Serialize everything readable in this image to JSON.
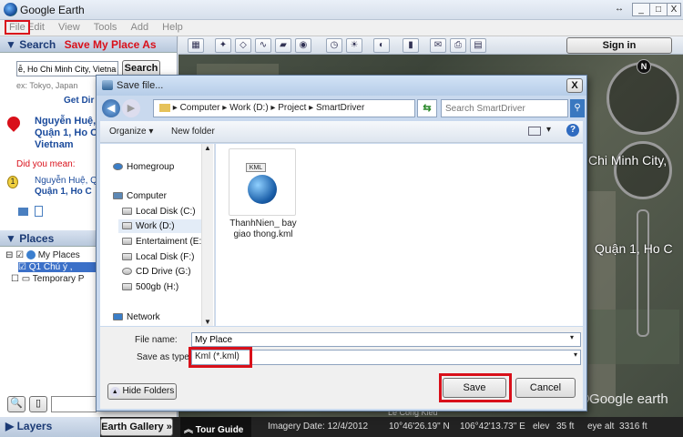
{
  "window": {
    "title": "Google Earth",
    "controls": {
      "resize": "↔",
      "minimize": "_",
      "maximize": "□",
      "close": "X"
    }
  },
  "menu": [
    "File",
    "Edit",
    "View",
    "Tools",
    "Add",
    "Help"
  ],
  "search_panel": {
    "header": "▼ Search",
    "annotation": "Save My Place As",
    "query": "ễ, Ho Chi Minh City, Vietnam",
    "search_button": "Search",
    "example": "ex: Tokyo, Japan",
    "get_directions": "Get Dir",
    "result_line1": "Nguyễn Huệ,",
    "result_line2": "Quận 1, Ho C",
    "result_line3": "Vietnam",
    "did_you_mean": "Did you mean:",
    "suggestion_line1": "Nguyễn Huệ, Q",
    "suggestion_line2": "Quận 1, Ho C"
  },
  "places_panel": {
    "header": "▼ Places",
    "my_places": "My Places",
    "item": "Q1 Chú ý ,",
    "temporary": "Temporary P"
  },
  "layers": {
    "header": "▶ Layers",
    "earth_gallery": "Earth Gallery »"
  },
  "toolbar": {
    "sign_in": "Sign in"
  },
  "map": {
    "label1": "Chi Minh City,",
    "label2": "Quận 1, Ho C",
    "watermark": "©Google earth",
    "compass": "N",
    "overlay_text": "Lê Công Kiều"
  },
  "status": {
    "tour_guide": "Tour Guide",
    "imagery_date": "Imagery Date: 12/4/2012",
    "lat": "10°46'26.19\" N",
    "lon": "106°42'13.73\" E",
    "elev_label": "elev",
    "elev": "35 ft",
    "eye_alt": "eye alt  3316 ft"
  },
  "dialog": {
    "title": "Save file...",
    "close": "X",
    "breadcrumb": [
      "Computer",
      "Work (D:)",
      "Project",
      "SmartDriver"
    ],
    "search_placeholder": "Search SmartDriver",
    "organize": "Organize ▾",
    "new_folder": "New folder",
    "nav": {
      "homegroup": "Homegroup",
      "computer": "Computer",
      "drives": [
        "Local Disk (C:)",
        "Work (D:)",
        "Entertaiment (E:)",
        "Local Disk (F:)",
        "CD Drive (G:)",
        "500gb (H:)"
      ],
      "network": "Network"
    },
    "file": {
      "icon_label": "KML",
      "name_line1": "ThanhNien_ bay",
      "name_line2": "giao thong.kml"
    },
    "file_name_label": "File name:",
    "file_name_value": "My Place",
    "save_type_label": "Save as type:",
    "save_type_value": "Kml (*.kml)",
    "hide_folders": "Hide Folders",
    "save": "Save",
    "cancel": "Cancel"
  },
  "colors": {
    "accent_red": "#d9101a",
    "title_blue": "#1b3a75"
  }
}
